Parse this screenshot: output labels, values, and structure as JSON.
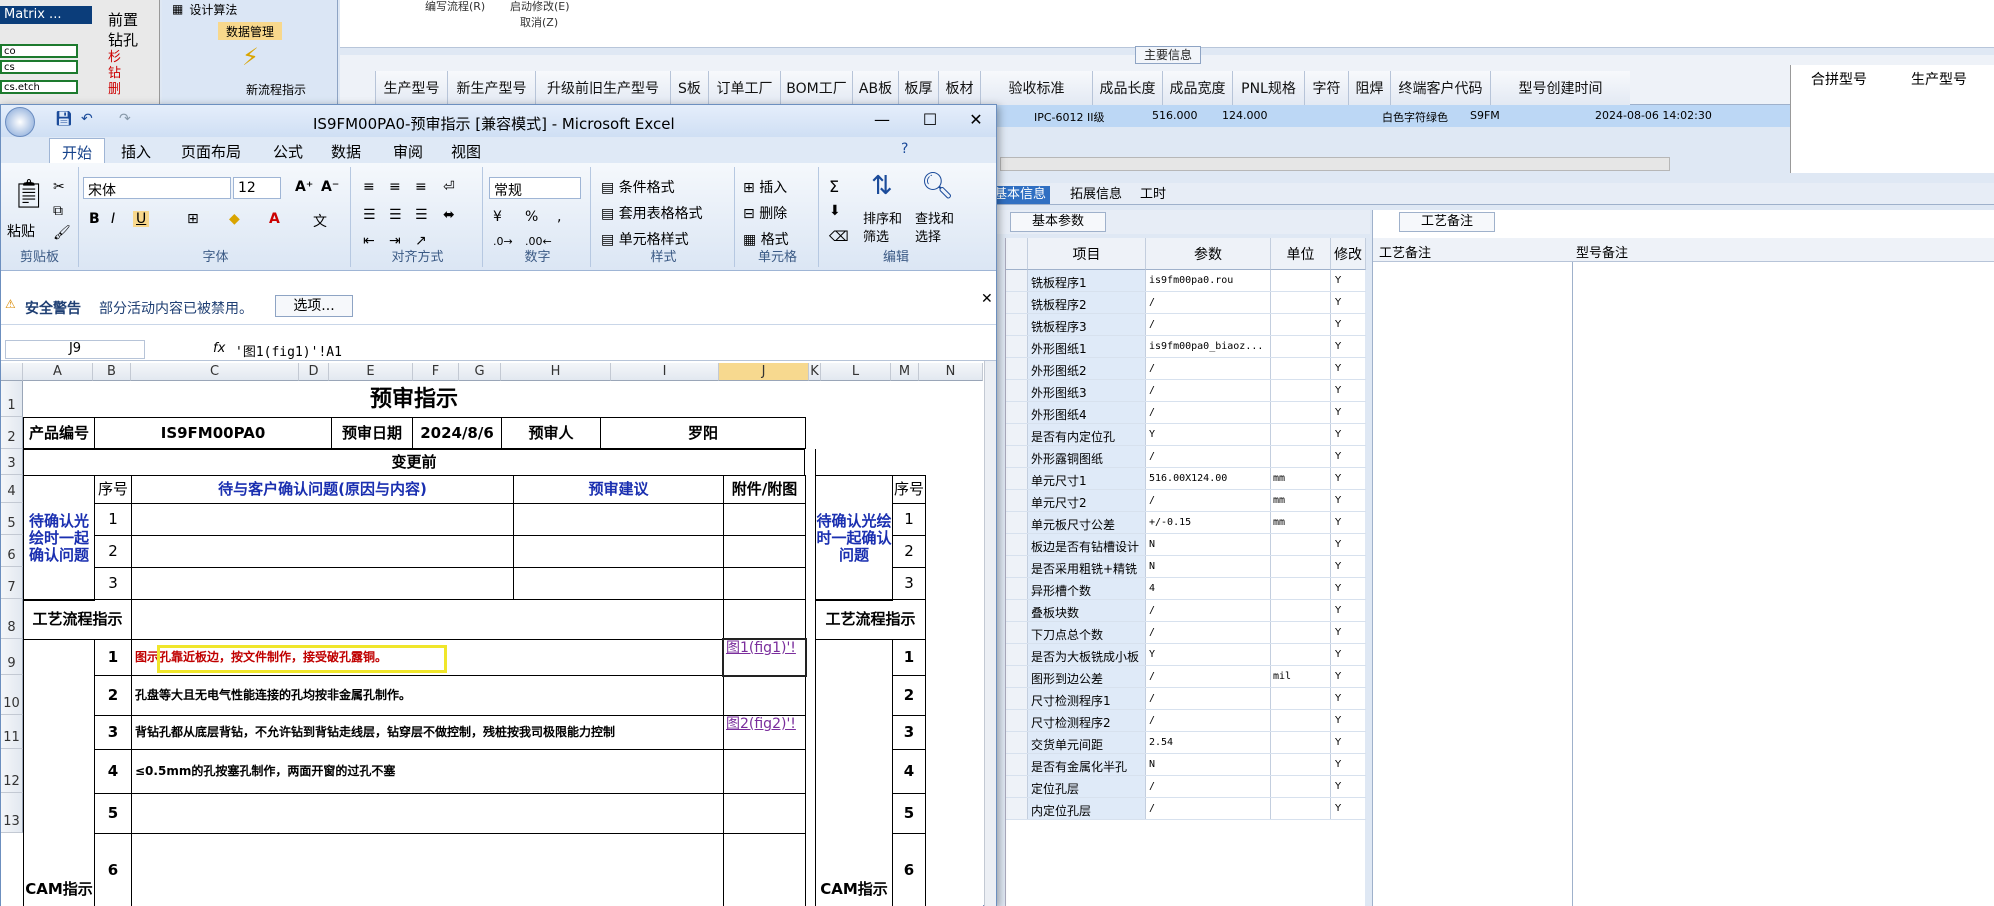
{
  "background_app": {
    "matrix_title": "Matrix ...",
    "mini_items": [
      "co",
      "cs",
      "cs.etch"
    ],
    "tree_items": [
      "前置",
      "钻孔"
    ],
    "tree_red": [
      "杉",
      "钻",
      "删"
    ],
    "tool_items": [
      "设计算法",
      "数据管理",
      "新流程指示"
    ],
    "menu_top": [
      "编写流程(R)",
      "启动修改(E)",
      "取消(Z)"
    ],
    "main_info_label": "主要信息",
    "grid_columns": [
      "生产型号",
      "新生产型号",
      "升级前旧生产型号",
      "S板",
      "订单工厂",
      "BOM工厂",
      "AB板",
      "板厚",
      "板材",
      "验收标准",
      "成品长度",
      "成品宽度",
      "PNL规格",
      "字符",
      "阻焊",
      "终端客户代码",
      "型号创建时间"
    ],
    "right_columns": [
      "合拼型号",
      "生产型号"
    ],
    "selected_row": {
      "standard": "IPC-6012 II级",
      "length": "516.000",
      "width": "124.000",
      "char": "白色字符",
      "mask": "绿色",
      "customer": "S9FM",
      "created": "2024-08-06 14:02:30"
    }
  },
  "param_panel": {
    "tabs": [
      "基本信息",
      "拓展信息",
      "工时"
    ],
    "sub_tab": "基本参数",
    "headers": [
      "项目",
      "参数",
      "单位",
      "修改"
    ],
    "rows": [
      {
        "item": "铣板程序1",
        "value": "is9fm00pa0.rou",
        "unit": "",
        "mod": "Y"
      },
      {
        "item": "铣板程序2",
        "value": "/",
        "unit": "",
        "mod": "Y"
      },
      {
        "item": "铣板程序3",
        "value": "/",
        "unit": "",
        "mod": "Y"
      },
      {
        "item": "外形图纸1",
        "value": "is9fm00pa0_biaoz...",
        "unit": "",
        "mod": "Y"
      },
      {
        "item": "外形图纸2",
        "value": "/",
        "unit": "",
        "mod": "Y"
      },
      {
        "item": "外形图纸3",
        "value": "/",
        "unit": "",
        "mod": "Y"
      },
      {
        "item": "外形图纸4",
        "value": "/",
        "unit": "",
        "mod": "Y"
      },
      {
        "item": "是否有内定位孔",
        "value": "Y",
        "unit": "",
        "mod": "Y"
      },
      {
        "item": "外形露铜图纸",
        "value": "/",
        "unit": "",
        "mod": "Y"
      },
      {
        "item": "单元尺寸1",
        "value": "516.00X124.00",
        "unit": "mm",
        "mod": "Y"
      },
      {
        "item": "单元尺寸2",
        "value": "/",
        "unit": "mm",
        "mod": "Y"
      },
      {
        "item": "单元板尺寸公差",
        "value": "+/-0.15",
        "unit": "mm",
        "mod": "Y"
      },
      {
        "item": "板边是否有钻槽设计",
        "value": "N",
        "unit": "",
        "mod": "Y"
      },
      {
        "item": "是否采用粗铣+精铣",
        "value": "N",
        "unit": "",
        "mod": "Y"
      },
      {
        "item": "异形槽个数",
        "value": "4",
        "unit": "",
        "mod": "Y"
      },
      {
        "item": "叠板块数",
        "value": "/",
        "unit": "",
        "mod": "Y"
      },
      {
        "item": "下刀点总个数",
        "value": "/",
        "unit": "",
        "mod": "Y"
      },
      {
        "item": "是否为大板铣成小板",
        "value": "Y",
        "unit": "",
        "mod": "Y"
      },
      {
        "item": "图形到边公差",
        "value": "/",
        "unit": "mil",
        "mod": "Y"
      },
      {
        "item": "尺寸检测程序1",
        "value": "/",
        "unit": "",
        "mod": "Y"
      },
      {
        "item": "尺寸检测程序2",
        "value": "/",
        "unit": "",
        "mod": "Y"
      },
      {
        "item": "交货单元间距",
        "value": "2.54",
        "unit": "",
        "mod": "Y"
      },
      {
        "item": "是否有金属化半孔",
        "value": "N",
        "unit": "",
        "mod": "Y"
      },
      {
        "item": "定位孔层",
        "value": "/",
        "unit": "",
        "mod": "Y"
      },
      {
        "item": "内定位孔层",
        "value": "/",
        "unit": "",
        "mod": "Y"
      }
    ]
  },
  "craft_panel": {
    "tab": "工艺备注",
    "headers": [
      "工艺备注",
      "型号备注"
    ]
  },
  "excel": {
    "title": "IS9FM00PA0-预审指示 [兼容模式] - Microsoft Excel",
    "ribbon_tabs": [
      "开始",
      "插入",
      "页面布局",
      "公式",
      "数据",
      "审阅",
      "视图"
    ],
    "font_name": "宋体",
    "font_size": "12",
    "number_format": "常规",
    "groups": [
      "剪贴板",
      "字体",
      "对齐方式",
      "数字",
      "样式",
      "单元格",
      "编辑"
    ],
    "paste_label": "粘贴",
    "styles_items": [
      "条件格式",
      "套用表格格式",
      "单元格样式"
    ],
    "cells_items": [
      "插入",
      "删除",
      "格式"
    ],
    "edit_items": [
      "排序和筛选",
      "查找和选择"
    ],
    "security_title": "安全警告",
    "security_text": "部分活动内容已被禁用。",
    "options_button": "选项...",
    "name_box": "J9",
    "formula": "'图1(fig1)'!A1",
    "fx": "fx"
  },
  "sheet": {
    "columns": [
      "A",
      "B",
      "C",
      "D",
      "E",
      "F",
      "G",
      "H",
      "I",
      "J",
      "K",
      "L",
      "M",
      "N"
    ],
    "rows": [
      "1",
      "2",
      "3",
      "4",
      "5",
      "6",
      "7",
      "8",
      "9",
      "10",
      "11",
      "12",
      "13"
    ],
    "title": "预审指示",
    "product_no_label": "产品编号",
    "product_no": "IS9FM00PA0",
    "date_label": "预审日期",
    "date": "2024/8/6",
    "reviewer_label": "预审人",
    "reviewer": "罗阳",
    "before_change": "变更前",
    "seq_label": "序号",
    "issue_header": "待与客户确认问题(原因与内容)",
    "advice_header": "预审建议",
    "attach_header": "附件/附图",
    "confirm_label": "待确认光绘时一起确认问题",
    "process_label": "工艺流程指示",
    "cam_label": "CAM指示",
    "seq": [
      "1",
      "2",
      "3"
    ],
    "cam_seq": [
      "1",
      "2",
      "3",
      "4",
      "5",
      "6"
    ],
    "cam_items": [
      "图示孔靠近板边，按文件制作，接受破孔露铜。",
      "孔盘等大且无电气性能连接的孔均按非金属孔制作。",
      "背钻孔都从底层背钻，不允许钻到背钻走线层，钻穿层不做控制，残桩按我司极限能力控制",
      "≤0.5mm的孔按塞孔制作，两面开窗的过孔不塞",
      "",
      ""
    ],
    "links": [
      "图1(fig1)'!",
      "",
      "图2(fig2)'!"
    ]
  }
}
